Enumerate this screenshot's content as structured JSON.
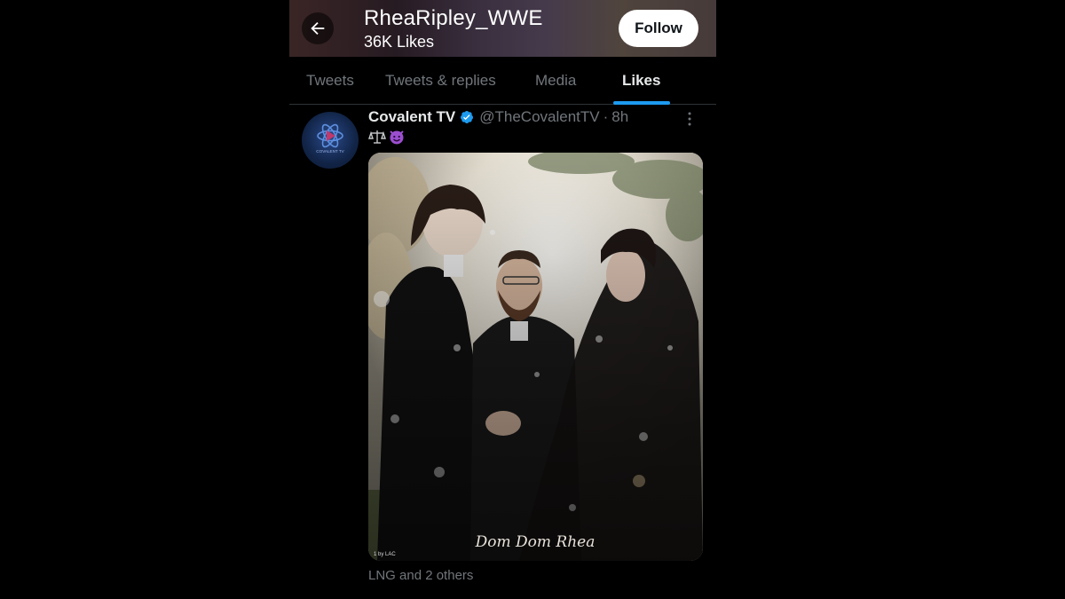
{
  "header": {
    "name": "RheaRipley_WWE",
    "subtitle": "36K Likes",
    "follow_label": "Follow"
  },
  "tabs": [
    {
      "label": "Tweets",
      "active": false
    },
    {
      "label": "Tweets & replies",
      "active": false
    },
    {
      "label": "Media",
      "active": false
    },
    {
      "label": "Likes",
      "active": true
    }
  ],
  "tweet": {
    "author": "Covalent TV",
    "handle": "@TheCovalentTV",
    "separator": "·",
    "time": "8h",
    "verified": true,
    "emojis": [
      "balance-scale-emoji",
      "smiling-imp-emoji"
    ],
    "avatar_text": "COVALENT TV",
    "media_caption": "Dom Dom Rhea",
    "media_credit": "1 by LAC",
    "liked_by": "LNG and 2 others"
  },
  "colors": {
    "accent": "#1d9bf0",
    "background": "#000000",
    "muted_text": "#71767b",
    "primary_text": "#e7e9ea"
  },
  "icons": [
    "back-arrow-icon",
    "verified-badge-icon",
    "more-options-icon"
  ]
}
